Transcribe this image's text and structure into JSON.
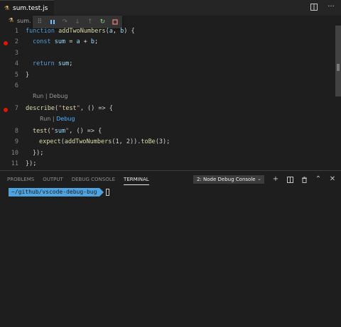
{
  "tab": {
    "label": "sum.test.js"
  },
  "breadcrumb": {
    "label": "sum."
  },
  "debug_toolbar": {
    "items": [
      "drag-icon",
      "pause-icon",
      "step-over-icon",
      "step-into-icon",
      "step-out-icon",
      "restart-icon",
      "stop-icon"
    ]
  },
  "colors": {
    "keyword": "#569cd6",
    "function": "#dcdcaa",
    "string": "#ce9178",
    "variable": "#9cdcfe",
    "breakpoint": "#e51400",
    "prompt": "#4fa3e0"
  },
  "code_lines": [
    {
      "num": "1",
      "text": "function addTwoNumbers(a, b) {"
    },
    {
      "num": "2",
      "text": "const sum = a + b;",
      "breakpoint": true
    },
    {
      "num": "3",
      "text": ""
    },
    {
      "num": "4",
      "text": "return sum;"
    },
    {
      "num": "5",
      "text": "}"
    },
    {
      "num": "6",
      "text": ""
    },
    {
      "num": "7",
      "text": "describe(\"test\", () => {",
      "breakpoint": true
    },
    {
      "num": "8",
      "text": "test(\"sum\", () => {"
    },
    {
      "num": "9",
      "text": "expect(addTwoNumbers(1, 2)).toBe(3);"
    },
    {
      "num": "10",
      "text": "});"
    },
    {
      "num": "11",
      "text": "});"
    }
  ],
  "codelens": {
    "run1": "Run",
    "sep1": "|",
    "debug1": "Debug",
    "run2": "Run",
    "sep2": "|",
    "debug2": "Debug"
  },
  "panel": {
    "tabs": [
      "PROBLEMS",
      "OUTPUT",
      "DEBUG CONSOLE",
      "TERMINAL"
    ],
    "active_tab": "TERMINAL",
    "select_value": "2: Node Debug Console",
    "actions": [
      "plus-icon",
      "split-icon",
      "trash-icon",
      "chevron-up-icon",
      "close-icon"
    ]
  },
  "terminal": {
    "path": "~/github/vscode-debug-bug"
  }
}
